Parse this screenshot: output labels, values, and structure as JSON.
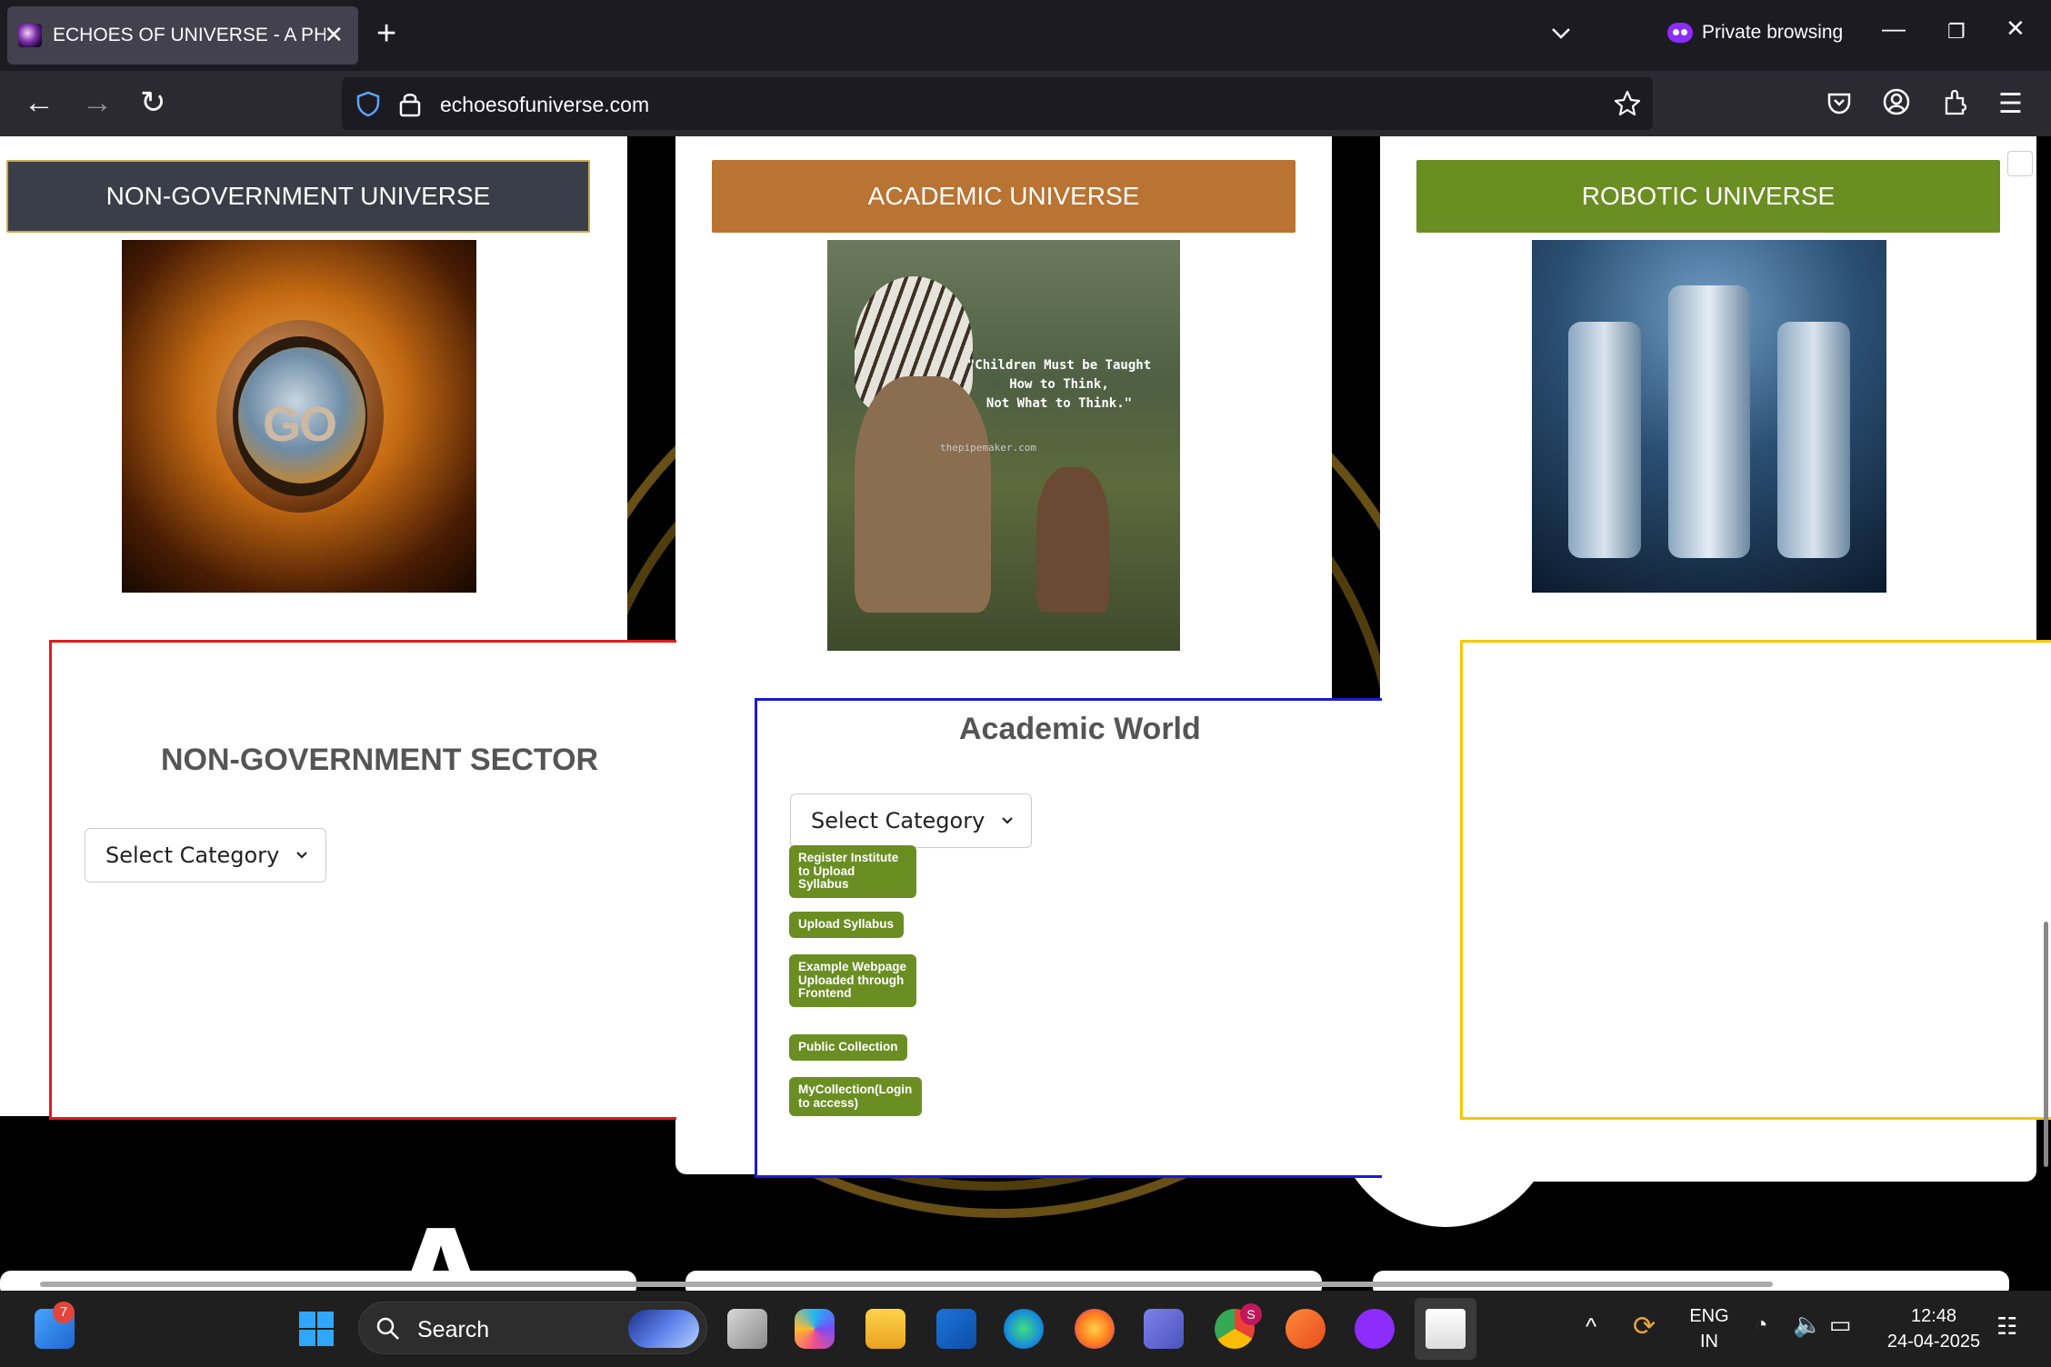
{
  "browser": {
    "tab_title": "ECHOES OF UNIVERSE - A PHRO",
    "private_label": "Private browsing",
    "url": "echoesofuniverse.com"
  },
  "cards": {
    "ngo": {
      "header": "NON-GOVERNMENT UNIVERSE",
      "header_color": "#3a3e48",
      "globe_text": "GO",
      "sector_title": "NON-GOVERNMENT SECTOR",
      "select_value": "Select Category",
      "frame_color": "#e01b1b"
    },
    "academic": {
      "header": "ACADEMIC UNIVERSE",
      "header_color": "#b97332",
      "image_quote_line1": "\"Children Must be Taught",
      "image_quote_line2": "How to Think,",
      "image_quote_line3": "Not What to Think.\"",
      "image_watermark": "thepipemaker.com",
      "world_title": "Academic World",
      "select_value": "Select Category",
      "frame_color": "#1a1ad6",
      "buttons": [
        "Register Institute to Upload Syllabus",
        "Upload Syllabus",
        "Example Webpage Uploaded through Frontend",
        "Public Collection",
        "MyCollection(Login to access)"
      ],
      "button_color": "#6b8e23"
    },
    "robotic": {
      "header": "ROBOTIC UNIVERSE",
      "header_color": "#6b8e23",
      "frame_color": "#f5c800"
    }
  },
  "taskbar": {
    "notification_count": "7",
    "search_label": "Search",
    "chrome_badge": "S",
    "lang_line1": "ENG",
    "lang_line2": "IN",
    "time": "12:48",
    "date": "24-04-2025"
  }
}
